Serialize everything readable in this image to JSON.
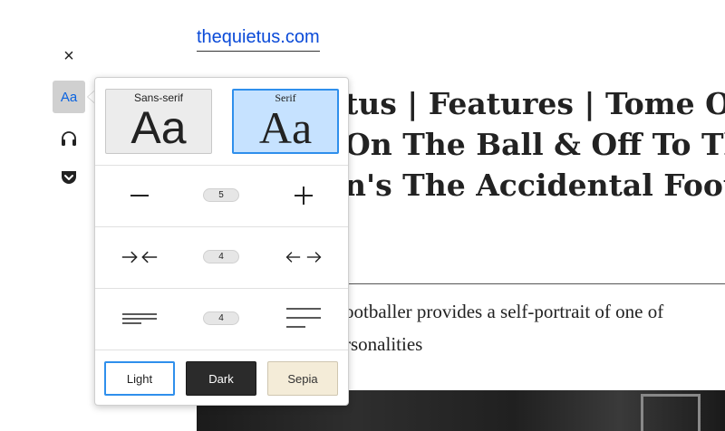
{
  "article": {
    "site_link": "thequietus.com",
    "headline_lines": [
      "tus | Features | Tome O",
      "On The Ball & Off To Th",
      "n's The Accidental Foot"
    ],
    "dek_lines": [
      "ootballer provides a self-portrait of one of",
      "rsonalities"
    ]
  },
  "toolbar": {
    "close_icon": "×",
    "type_controls_label": "Aa",
    "listen_icon": "headphones-icon",
    "pocket_icon": "pocket-icon"
  },
  "reader_panel": {
    "fonts": [
      {
        "caption": "Sans-serif",
        "sample": "Aa",
        "selected": false
      },
      {
        "caption": "Serif",
        "sample": "Aa",
        "selected": true
      }
    ],
    "font_size_value": "5",
    "content_width_value": "4",
    "line_height_value": "4",
    "themes": [
      "Light",
      "Dark",
      "Sepia"
    ],
    "selected_theme": "Light"
  },
  "colors": {
    "accent": "#2f8fec",
    "link": "#0a4ad8",
    "selected_font_bg": "#c6e2ff",
    "dark_theme": "#2b2b2b",
    "sepia_theme": "#f4ecd8"
  }
}
